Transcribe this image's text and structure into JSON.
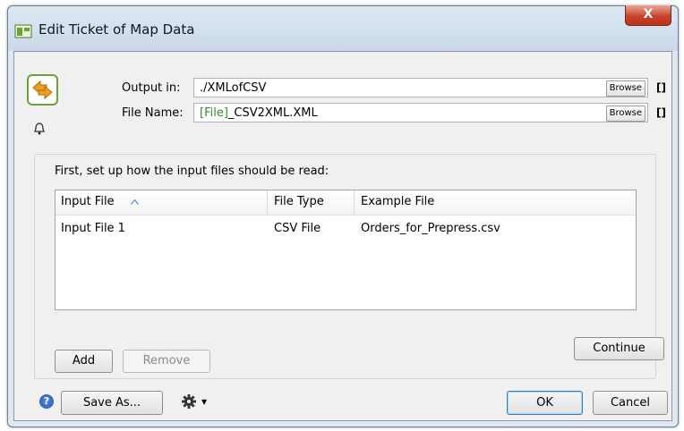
{
  "window": {
    "title": "Edit Ticket of Map Data",
    "close_label": "X"
  },
  "output": {
    "label": "Output in:",
    "value": "./XMLofCSV",
    "browse_label": "Browse",
    "bracket": "[]"
  },
  "filename": {
    "label": "File Name:",
    "tag": "[File]",
    "suffix": "_CSV2XML.XML",
    "browse_label": "Browse",
    "bracket": "[]"
  },
  "input_section": {
    "label": "First, set up how the input files should be read:",
    "columns": [
      "Input File",
      "File Type",
      "Example File"
    ],
    "rows": [
      [
        "Input File 1",
        "CSV File",
        "Orders_for_Prepress.csv"
      ]
    ],
    "add_label": "Add",
    "remove_label": "Remove",
    "continue_label": "Continue"
  },
  "footer": {
    "help_icon": "question-icon",
    "save_as_label": "Save As...",
    "ok_label": "OK",
    "cancel_label": "Cancel"
  },
  "colors": {
    "title_bar": "#c9d8ea",
    "close_button": "#c8452d",
    "file_tag": "#2f8c2f",
    "icon_accent": "#f0a020"
  }
}
